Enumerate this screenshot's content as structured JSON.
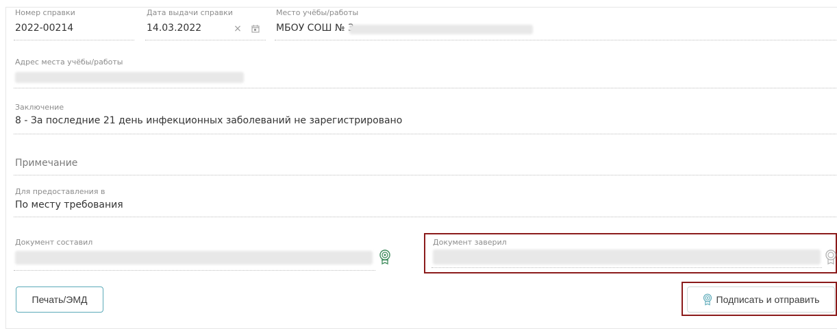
{
  "fields": {
    "certificate_number": {
      "label": "Номер справки",
      "value": "2022-00214"
    },
    "issue_date": {
      "label": "Дата выдачи справки",
      "value": "14.03.2022",
      "clear_symbol": "×"
    },
    "place": {
      "label": "Место учёбы/работы",
      "value": "МБОУ СОШ № 3"
    },
    "address": {
      "label": "Адрес места учёбы/работы"
    },
    "conclusion": {
      "label": "Заключение",
      "value": "8 - За последние 21 день инфекционных заболеваний не зарегистрировано"
    },
    "note": {
      "placeholder": "Примечание"
    },
    "provision": {
      "label": "Для предоставления в",
      "value": "По месту требования"
    },
    "composed_by": {
      "label": "Документ составил"
    },
    "certified_by": {
      "label": "Документ заверил"
    }
  },
  "buttons": {
    "print": "Печать/ЭМД",
    "sign_send": "Подписать и отправить"
  },
  "icons": {
    "calendar": "calendar-icon",
    "clear": "clear-icon",
    "signature": "certificate-icon"
  },
  "colors": {
    "accent": "#5aa9b8",
    "cert_icon": "#3c8a5a",
    "cert_icon_muted": "#b5b5b5",
    "highlight": "#8b1a1a"
  }
}
